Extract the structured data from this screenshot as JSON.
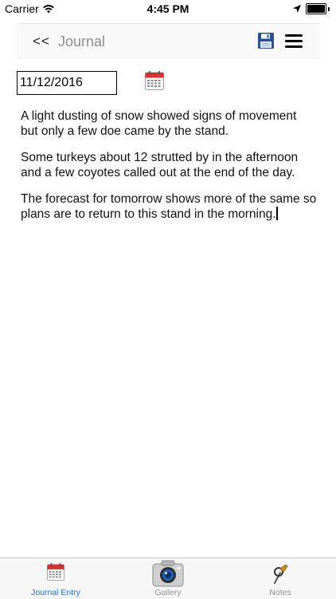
{
  "status_bar": {
    "carrier": "Carrier",
    "time": "4:45 PM",
    "battery_level": 1.0
  },
  "header": {
    "back_label": "<<",
    "title": "Journal",
    "icons": [
      "save-icon",
      "menu-icon"
    ]
  },
  "entry": {
    "date_value": "11/12/2016",
    "paragraphs": [
      "A light dusting of snow showed signs of movement but only a few doe came by the stand.",
      "Some turkeys about 12 strutted by in the afternoon and a few coyotes called out at the end of the day.",
      "The forecast for tomorrow shows more of the same so plans are to return to this stand in the morning."
    ]
  },
  "tabs": [
    {
      "label": "Journal Entry",
      "icon": "calendar-icon",
      "active": true
    },
    {
      "label": "Gallery",
      "icon": "camera-icon",
      "active": false
    },
    {
      "label": "Notes",
      "icon": "pin-icon",
      "active": false
    }
  ],
  "colors": {
    "accent": "#1a73d9",
    "calendar_red": "#d93030",
    "save_blue": "#2b4f8f",
    "inactive_tab": "#929292"
  }
}
